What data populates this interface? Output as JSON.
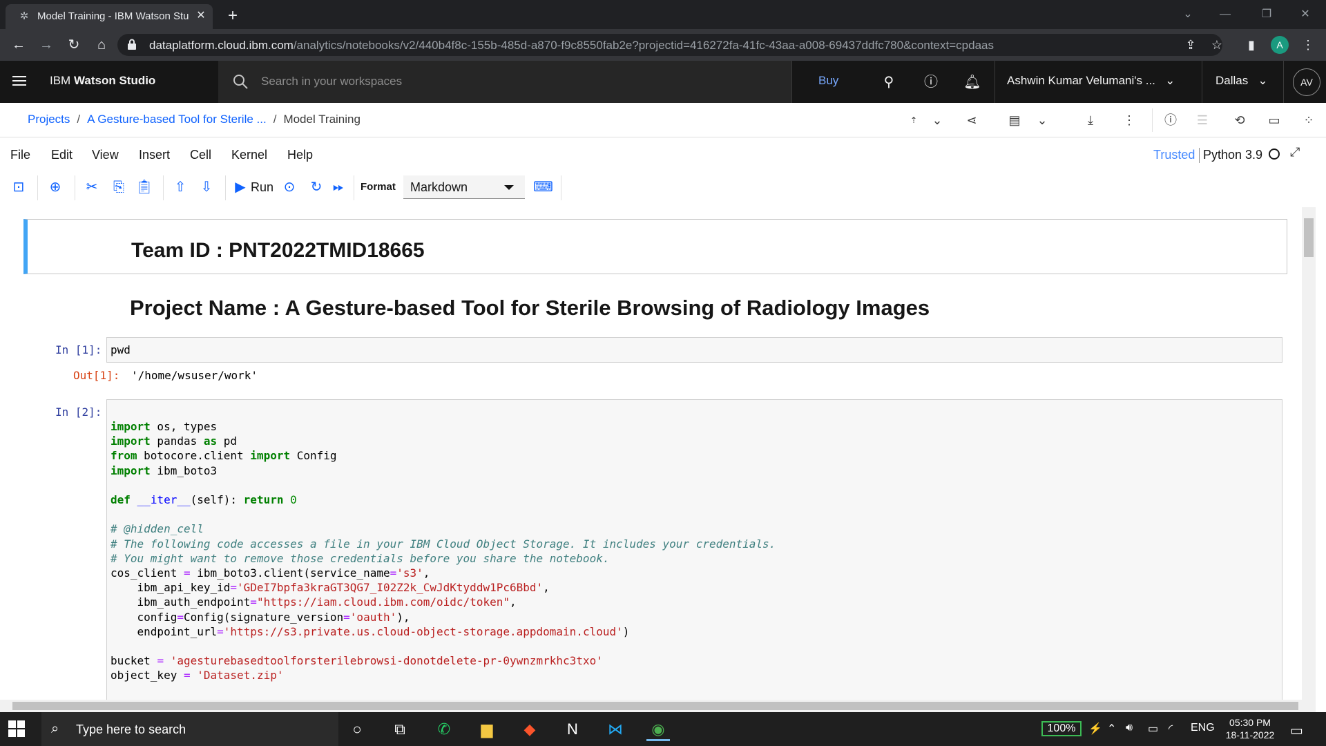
{
  "browser": {
    "tab_title": "Model Training - IBM Watson Stu",
    "url_host": "dataplatform.cloud.ibm.com",
    "url_path": "/analytics/notebooks/v2/440b4f8c-155b-485d-a870-f9c8550fab2e?projectid=416272fa-41fc-43aa-a008-69437ddfc780&context=cpdaas",
    "profile_initial": "A"
  },
  "ibm_header": {
    "brand_prefix": "IBM",
    "brand_name": "Watson Studio",
    "search_placeholder": "Search in your workspaces",
    "buy_label": "Buy",
    "account_label": "Ashwin Kumar Velumani's ...",
    "region_label": "Dallas",
    "avatar_initials": "AV"
  },
  "breadcrumb": {
    "items": [
      "Projects",
      "A Gesture-based Tool for Sterile ...",
      "Model Training"
    ]
  },
  "menu": {
    "items": [
      "File",
      "Edit",
      "View",
      "Insert",
      "Cell",
      "Kernel",
      "Help"
    ],
    "trusted": "Trusted",
    "kernel": "Python 3.9"
  },
  "toolbar": {
    "run_label": "Run",
    "format_label": "Format",
    "format_value": "Markdown"
  },
  "notebook": {
    "team_id": "Team ID : PNT2022TMID18665",
    "project_name": "Project Name : A Gesture-based Tool for Sterile Browsing of Radiology Images",
    "cell1": {
      "prompt": "In [1]:",
      "code": "pwd",
      "out_prompt": "Out[1]:",
      "output": "'/home/wsuser/work'"
    },
    "cell2": {
      "prompt": "In [2]:"
    }
  },
  "taskbar": {
    "search_placeholder": "Type here to search",
    "battery": "100%",
    "language": "ENG",
    "time": "05:30 PM",
    "date": "18-11-2022"
  },
  "colors": {
    "ibm_blue": "#0f62fe",
    "header_dark": "#161616",
    "cell_accent": "#42a5f5"
  }
}
